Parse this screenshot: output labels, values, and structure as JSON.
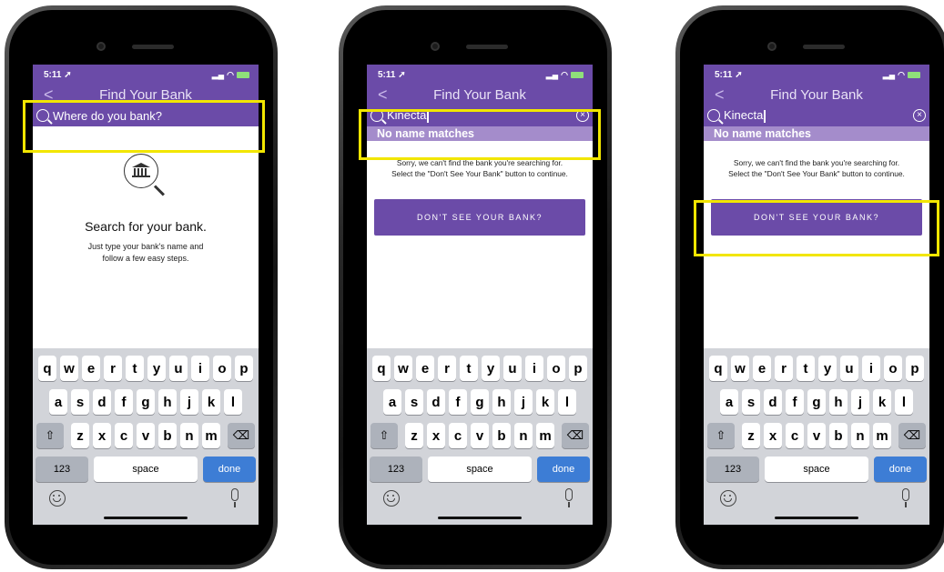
{
  "screens": [
    {
      "status": {
        "time": "5:11 ➚"
      },
      "nav": {
        "back": "<",
        "title": "Find Your Bank"
      },
      "search": {
        "placeholder": "Where do you bank?"
      },
      "empty": {
        "title": "Search for your bank.",
        "line1": "Just type your bank's name and",
        "line2": "follow a few easy steps."
      }
    },
    {
      "status": {
        "time": "5:11 ➚"
      },
      "nav": {
        "back": "<",
        "title": "Find Your Bank"
      },
      "search": {
        "value": "Kinecta",
        "clear": "×"
      },
      "no_match": "No name matches",
      "sorry": {
        "line1": "Sorry, we can't find the bank you're searching for.",
        "line2": "Select the \"Don't See Your Bank\" button to continue."
      },
      "cta": "DON'T SEE YOUR BANK?"
    },
    {
      "status": {
        "time": "5:11 ➚"
      },
      "nav": {
        "back": "<",
        "title": "Find Your Bank"
      },
      "search": {
        "value": "Kinecta",
        "clear": "×"
      },
      "no_match": "No name matches",
      "sorry": {
        "line1": "Sorry, we can't find the bank you're searching for.",
        "line2": "Select the \"Don't See Your Bank\" button to continue."
      },
      "cta": "DON'T SEE YOUR BANK?"
    }
  ],
  "keyboard": {
    "row1": [
      "q",
      "w",
      "e",
      "r",
      "t",
      "y",
      "u",
      "i",
      "o",
      "p"
    ],
    "row2": [
      "a",
      "s",
      "d",
      "f",
      "g",
      "h",
      "j",
      "k",
      "l"
    ],
    "row3": [
      "z",
      "x",
      "c",
      "v",
      "b",
      "n",
      "m"
    ],
    "shift": "⇧",
    "delete": "⌫",
    "numbers": "123",
    "space": "space",
    "done": "done"
  },
  "highlight_color": "#f2e600",
  "accent": "#6b4ba8"
}
